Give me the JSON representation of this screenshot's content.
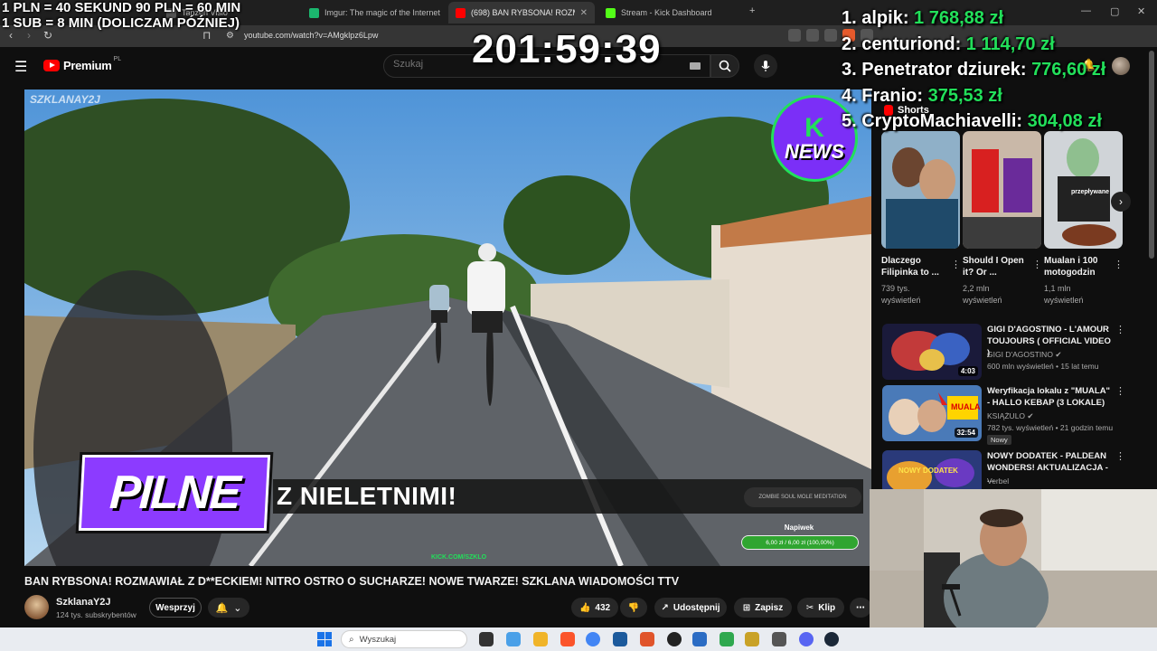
{
  "browser": {
    "tabs": [
      {
        "title": "Tanzen Visio",
        "color": "#555555",
        "active": false
      },
      {
        "title": "Imgur: The magic of the Internet",
        "color": "#1bb76e",
        "active": false
      },
      {
        "title": "(698) BAN RYBSONA! ROZMA",
        "color": "#ff0000",
        "active": true
      },
      {
        "title": "Stream - Kick Dashboard",
        "color": "#53fc18",
        "active": false
      }
    ],
    "new_tab": "+",
    "url": "youtube.com/watch?v=AMgklpz6Lpw"
  },
  "overlay": {
    "rules_line1": "1 PLN =  40 SEKUND 90 PLN = 60 MIN",
    "rules_line2": "1 SUB = 8 MIN (DOLICZAM PÓŹNIEJ)",
    "timer": "201:59:39",
    "donors": [
      {
        "name": "1. alpik: ",
        "amount": "1 768,88 zł"
      },
      {
        "name": "2. centuriond: ",
        "amount": "1 114,70 zł"
      },
      {
        "name": "3. Penetrator dziurek: ",
        "amount": "776,60 zł"
      },
      {
        "name": "4. Franio: ",
        "amount": "375,53 zł"
      },
      {
        "name": "5. CryptoMachiavelli: ",
        "amount": "304,08 zł"
      }
    ]
  },
  "youtube": {
    "logo_text": "Premium",
    "logo_region": "PL",
    "search_placeholder": "Szukaj",
    "video": {
      "watermark": "SZKLANAY2J",
      "knews_k": "K",
      "knews_label": "NEWS",
      "pilne": "PILNE",
      "ticker": "Z NIELETNIMI!",
      "ticker_logo": "ZOMBIE SOUL MOLE MEDITATION",
      "goal_label": "Napiwek",
      "goal_text": "6,00 zł / 6,00 zł (100,00%)",
      "goal_progress": 1.0,
      "kick_tag": "KICK.COM/SZKLO"
    },
    "title": "BAN RYBSONA! ROZMAWIAŁ Z D**ECKIEM! NITRO OSTRO O SUCHARZE! NOWE TWARZE! SZKLANA WIADOMOŚCI TTV",
    "channel": {
      "name": "SzklanaY2J",
      "subs": "124 tys. subskrybentów"
    },
    "support_label": "Wesprzyj",
    "likes": "432",
    "share_label": "Udostępnij",
    "save_label": "Zapisz",
    "clip_label": "Klip",
    "shorts_label": "Shorts",
    "shorts": [
      {
        "title": "Dlaczego Filipinka to ...",
        "views1": "739 tys.",
        "views2": "wyświetleń"
      },
      {
        "title": "Should I Open it? Or ...",
        "views1": "2,2 mln",
        "views2": "wyświetleń"
      },
      {
        "title": "Mualan i 100 motogodzin",
        "views1": "1,1 mln",
        "views2": "wyświetleń"
      }
    ],
    "short_overlay_text": "przepływane",
    "recommended": [
      {
        "title": "GIGI D'AGOSTINO - L'AMOUR TOUJOURS ( OFFICIAL VIDEO )",
        "channel": "GIGI D'AGOSTINO",
        "meta": "600 mln wyświetleń • 15 lat temu",
        "duration": "4:03",
        "badge": ""
      },
      {
        "title": "Weryfikacja lokalu z \"MUALA\" - HALLO KEBAP (3 LOKALE)",
        "channel": "KSIĄŻULO",
        "meta": "782 tys. wyświetleń • 21 godzin temu",
        "duration": "32:54",
        "badge": "Nowy"
      },
      {
        "title": "NOWY DODATEK - PALDEAN WONDERS! AKTUALIZACJA - ...",
        "channel": "Verbel",
        "meta": "",
        "duration": "",
        "badge": ""
      }
    ],
    "rec_thumb_texts": [
      "MUALA",
      "NOWY DODATEK"
    ]
  },
  "taskbar": {
    "search_placeholder": "Wyszukaj"
  }
}
